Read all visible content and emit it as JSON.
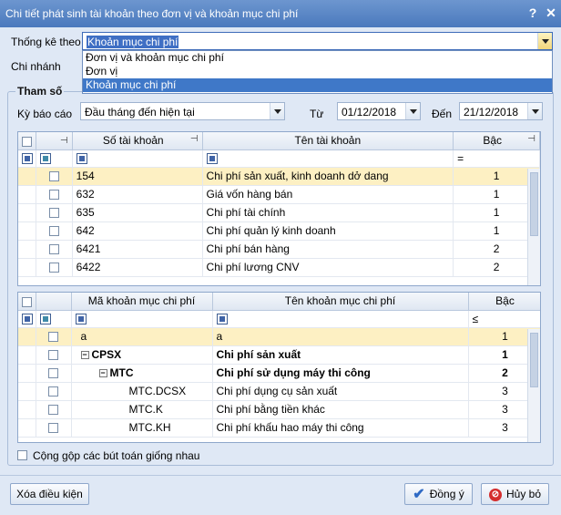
{
  "window": {
    "title": "Chi tiết phát sinh tài khoản theo đơn vị và khoản mục chi phí",
    "help": "?",
    "close": "✕"
  },
  "stat_by": {
    "label": "Thống kê theo",
    "value": "Khoản mục chi phí",
    "options": [
      "Đơn vị và khoản mục chi phí",
      "Đơn vị",
      "Khoản mục chi phí"
    ]
  },
  "branch": {
    "label": "Chi nhánh"
  },
  "params": {
    "legend": "Tham số"
  },
  "period": {
    "label": "Kỳ báo cáo",
    "value": "Đầu tháng đến hiện tại",
    "from_label": "Từ",
    "from": "01/12/2018",
    "to_label": "Đến",
    "to": "21/12/2018"
  },
  "accounts": {
    "headers": {
      "code": "Số tài khoản",
      "name": "Tên tài khoản",
      "level": "Bậc"
    },
    "filter": {
      "level_op": "="
    },
    "rows": [
      {
        "code": "154",
        "name": "Chi phí sản xuất, kinh doanh dở dang",
        "level": "1"
      },
      {
        "code": "632",
        "name": "Giá vốn hàng bán",
        "level": "1"
      },
      {
        "code": "635",
        "name": "Chi phí tài chính",
        "level": "1"
      },
      {
        "code": "642",
        "name": "Chi phí quản lý kinh doanh",
        "level": "1"
      },
      {
        "code": "6421",
        "name": "Chi phí bán hàng",
        "level": "2"
      },
      {
        "code": "6422",
        "name": "Chi phí lương CNV",
        "level": "2"
      }
    ]
  },
  "cost_items": {
    "headers": {
      "code": "Mã khoản mục chi phí",
      "name": "Tên khoản mục chi phí",
      "level": "Bậc"
    },
    "filter": {
      "level_op": "≤"
    },
    "rows": [
      {
        "code": "a",
        "name": "a",
        "level": "1"
      },
      {
        "code": "CPSX",
        "name": "Chi phí sản xuất",
        "level": "1"
      },
      {
        "code": "MTC",
        "name": "Chi phí sử dụng máy thi công",
        "level": "2"
      },
      {
        "code": "MTC.DCSX",
        "name": "Chi phí dụng cụ sản xuất",
        "level": "3"
      },
      {
        "code": "MTC.K",
        "name": "Chi phí bằng tiền khác",
        "level": "3"
      },
      {
        "code": "MTC.KH",
        "name": "Chi phí khấu hao máy thi công",
        "level": "3"
      }
    ]
  },
  "merge": {
    "label": "Cộng gộp các bút toán giống nhau"
  },
  "buttons": {
    "clear": "Xóa điều kiện",
    "ok": "Đồng ý",
    "cancel": "Hủy bỏ"
  }
}
